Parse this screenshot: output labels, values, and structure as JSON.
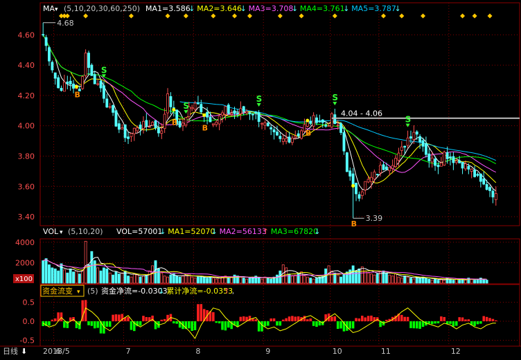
{
  "colors": {
    "bg": "#000000",
    "grid": "#8b0000",
    "axis_text": "#c8c8c8",
    "up": "#ff5050",
    "down": "#54ffff",
    "ma1": "#ffffff",
    "ma2": "#ffff00",
    "ma3": "#ff55ff",
    "ma4": "#00ff00",
    "ma5": "#00c8ff",
    "marker_b": "#ff8c00",
    "marker_s": "#33ff33",
    "flow_pos": "#ff2020",
    "flow_neg": "#00ff00",
    "flow_line": "#ffff00",
    "diamond": "#ffc800",
    "resistance": "#c0c0c0"
  },
  "price_panel": {
    "label": "MA",
    "params": "(5,10,20,30,60,250)",
    "legend": [
      {
        "text": "MA1=3.586",
        "arrow": "↓",
        "color": "#ffffff"
      },
      {
        "text": "MA2=3.646",
        "arrow": "↓",
        "color": "#ffff00"
      },
      {
        "text": "MA3=3.708",
        "arrow": "↓",
        "color": "#ff55ff"
      },
      {
        "text": "MA4=3.761",
        "arrow": "↓",
        "color": "#00ff00"
      },
      {
        "text": "MA5=3.787",
        "arrow": "↓",
        "color": "#00c8ff"
      }
    ],
    "annot_high": "4.68",
    "annot_low": "3.39",
    "annot_range": "4.04 - 4.06"
  },
  "vol_panel": {
    "label": "VOL",
    "params": "(5,10,20)",
    "legend": [
      {
        "text": "VOL=57001",
        "arrow": "↓",
        "color": "#ffffff"
      },
      {
        "text": "MA1=52070",
        "arrow": "↓",
        "color": "#ffff00"
      },
      {
        "text": "MA2=56133",
        "arrow": "↑",
        "color": "#ff55ff"
      },
      {
        "text": "MA3=67820",
        "arrow": "↓",
        "color": "#00ff00"
      }
    ],
    "unit": "x100"
  },
  "flow_panel": {
    "label": "资金流变",
    "params": "(5)",
    "legend": [
      {
        "text": "资金净流=-0.0303",
        "arrow": "↓",
        "color": "#ffffff"
      },
      {
        "text": "累计净流=-0.0353",
        "arrow": "↑",
        "color": "#ffff00"
      }
    ],
    "trail": ","
  },
  "bottom_bar": {
    "period": "日线",
    "months": [
      {
        "label": "2018/5",
        "at": 0
      },
      {
        "label": "6",
        "at": 4
      },
      {
        "label": "7",
        "at": 27
      },
      {
        "label": "8",
        "at": 50
      },
      {
        "label": "9",
        "at": 73
      },
      {
        "label": "10",
        "at": 95
      },
      {
        "label": "11",
        "at": 111
      },
      {
        "label": "12",
        "at": 134
      }
    ]
  },
  "chart_data": {
    "type": "candlestick",
    "y_ticks": [
      4.6,
      4.4,
      4.2,
      4.0,
      3.8,
      3.6,
      3.4
    ],
    "y_tick_labels": [
      "4.60",
      "4.40",
      "4.20",
      "4.00",
      "3.80",
      "3.60",
      "3.40"
    ],
    "ylim": [
      3.35,
      4.72
    ],
    "vol_ticks": [
      4000,
      2000
    ],
    "vol_tick_labels": [
      "4000",
      "2000"
    ],
    "vol_ylim": [
      0,
      4400
    ],
    "flow_ticks": [
      0.5,
      0.0,
      -0.5
    ],
    "flow_tick_labels": [
      "0.5",
      "0.0",
      "-0.5"
    ],
    "flow_ylim": [
      -0.6,
      0.62
    ],
    "resistance": 4.05,
    "close_anchors": [
      [
        0,
        4.6
      ],
      [
        2,
        4.45
      ],
      [
        5,
        4.25
      ],
      [
        9,
        4.28
      ],
      [
        12,
        4.22
      ],
      [
        14,
        4.48
      ],
      [
        16,
        4.32
      ],
      [
        19,
        4.25
      ],
      [
        22,
        4.1
      ],
      [
        25,
        3.98
      ],
      [
        28,
        3.92
      ],
      [
        31,
        4.0
      ],
      [
        34,
        4.0
      ],
      [
        36,
        4.02
      ],
      [
        39,
        3.95
      ],
      [
        41,
        4.22
      ],
      [
        43,
        4.08
      ],
      [
        45,
        3.97
      ],
      [
        48,
        4.12
      ],
      [
        51,
        4.14
      ],
      [
        54,
        4.06
      ],
      [
        57,
        4.03
      ],
      [
        60,
        4.1
      ],
      [
        63,
        4.08
      ],
      [
        66,
        4.1
      ],
      [
        69,
        4.09
      ],
      [
        72,
        4.03
      ],
      [
        75,
        3.95
      ],
      [
        78,
        3.9
      ],
      [
        81,
        3.92
      ],
      [
        84,
        3.95
      ],
      [
        87,
        4.02
      ],
      [
        90,
        4.05
      ],
      [
        93,
        4.0
      ],
      [
        95,
        4.05
      ],
      [
        98,
        3.95
      ],
      [
        100,
        3.72
      ],
      [
        102,
        3.58
      ],
      [
        104,
        3.55
      ],
      [
        106,
        3.62
      ],
      [
        108,
        3.65
      ],
      [
        111,
        3.72
      ],
      [
        114,
        3.75
      ],
      [
        117,
        3.8
      ],
      [
        120,
        3.92
      ],
      [
        122,
        3.97
      ],
      [
        124,
        3.92
      ],
      [
        127,
        3.78
      ],
      [
        130,
        3.75
      ],
      [
        132,
        3.82
      ],
      [
        135,
        3.78
      ],
      [
        138,
        3.75
      ],
      [
        141,
        3.7
      ],
      [
        144,
        3.62
      ],
      [
        147,
        3.58
      ],
      [
        149,
        3.53
      ]
    ],
    "high_point": {
      "index": 0,
      "value": 4.68
    },
    "low_point": {
      "index": 102,
      "value": 3.39
    },
    "buy_signals": [
      11,
      43,
      53,
      87,
      102
    ],
    "sell_signals": [
      20,
      47,
      71,
      96,
      120
    ],
    "diamond_markers": [
      6,
      7,
      8,
      14,
      29,
      41,
      47,
      56,
      63,
      68,
      78,
      85,
      96,
      112,
      118,
      125,
      138,
      142,
      147
    ],
    "vol_samples": [
      2200,
      2400,
      1800,
      1500,
      1400,
      1200,
      1900,
      1300,
      1000,
      1400,
      1100,
      1200,
      900,
      1300,
      4100,
      1800,
      3100,
      2200,
      1500,
      1200,
      1500,
      1400,
      1000,
      800,
      1100,
      900,
      1000,
      1200,
      700,
      600,
      900,
      800,
      600,
      700,
      800,
      1200,
      1700,
      2200,
      1400,
      1000,
      700,
      600,
      800,
      900,
      700,
      600,
      700,
      800,
      900,
      600,
      500,
      600,
      700,
      600,
      500,
      600,
      500,
      400,
      500,
      600,
      700,
      500,
      600,
      800,
      700,
      600,
      500,
      400,
      500,
      600,
      700,
      500,
      400,
      600,
      500,
      400,
      600,
      800,
      1200,
      1800,
      1500,
      900,
      700,
      800,
      1000,
      1100,
      700,
      600,
      500,
      400,
      500,
      600,
      700,
      1400,
      1700,
      1200,
      1000,
      800,
      600,
      900,
      1100,
      1300,
      1700,
      1200,
      1400,
      1600,
      1200,
      1000,
      900,
      800,
      900,
      1100,
      1200,
      1000,
      800,
      700,
      900,
      600,
      500,
      700,
      600,
      500,
      400,
      600,
      500,
      600,
      500,
      400,
      300,
      400,
      300,
      400,
      300,
      500,
      400,
      300,
      400,
      300,
      400,
      300,
      500,
      400,
      300,
      400,
      500,
      400,
      300
    ],
    "flow_line_anchors": [
      [
        0,
        -0.05
      ],
      [
        2,
        -0.15
      ],
      [
        4,
        -0.1
      ],
      [
        6,
        0.1
      ],
      [
        8,
        -0.05
      ],
      [
        10,
        0.05
      ],
      [
        12,
        -0.1
      ],
      [
        14,
        0.35
      ],
      [
        16,
        0.25
      ],
      [
        18,
        0.1
      ],
      [
        20,
        -0.15
      ],
      [
        22,
        -0.25
      ],
      [
        24,
        -0.1
      ],
      [
        26,
        0.05
      ],
      [
        28,
        0.15
      ],
      [
        30,
        -0.05
      ],
      [
        32,
        -0.15
      ],
      [
        34,
        -0.05
      ],
      [
        36,
        0.05
      ],
      [
        38,
        -0.1
      ],
      [
        40,
        -0.05
      ],
      [
        42,
        0.1
      ],
      [
        44,
        0.05
      ],
      [
        46,
        -0.1
      ],
      [
        48,
        -0.25
      ],
      [
        50,
        -0.45
      ],
      [
        52,
        -0.1
      ],
      [
        54,
        0.15
      ],
      [
        56,
        0.35
      ],
      [
        58,
        0.3
      ],
      [
        60,
        0.1
      ],
      [
        62,
        -0.05
      ],
      [
        64,
        -0.15
      ],
      [
        66,
        -0.05
      ],
      [
        68,
        0.05
      ],
      [
        70,
        0.1
      ],
      [
        72,
        -0.1
      ],
      [
        74,
        -0.2
      ],
      [
        76,
        -0.15
      ],
      [
        78,
        -0.25
      ],
      [
        80,
        -0.2
      ],
      [
        82,
        -0.1
      ],
      [
        84,
        0.0
      ],
      [
        86,
        0.1
      ],
      [
        88,
        0.15
      ],
      [
        90,
        0.05
      ],
      [
        92,
        -0.05
      ],
      [
        94,
        0.1
      ],
      [
        96,
        0.2
      ],
      [
        98,
        0.05
      ],
      [
        100,
        -0.15
      ],
      [
        102,
        -0.3
      ],
      [
        104,
        -0.25
      ],
      [
        106,
        -0.15
      ],
      [
        108,
        -0.05
      ],
      [
        110,
        0.05
      ],
      [
        112,
        -0.05
      ],
      [
        114,
        0.0
      ],
      [
        116,
        0.1
      ],
      [
        118,
        0.25
      ],
      [
        120,
        0.35
      ],
      [
        122,
        0.2
      ],
      [
        124,
        0.05
      ],
      [
        126,
        -0.05
      ],
      [
        128,
        -0.1
      ],
      [
        130,
        -0.15
      ],
      [
        132,
        -0.05
      ],
      [
        134,
        -0.1
      ],
      [
        136,
        -0.2
      ],
      [
        138,
        -0.1
      ],
      [
        140,
        -0.05
      ],
      [
        142,
        -0.15
      ],
      [
        144,
        -0.2
      ],
      [
        146,
        -0.1
      ],
      [
        148,
        -0.05
      ],
      [
        149,
        -0.05
      ]
    ]
  }
}
